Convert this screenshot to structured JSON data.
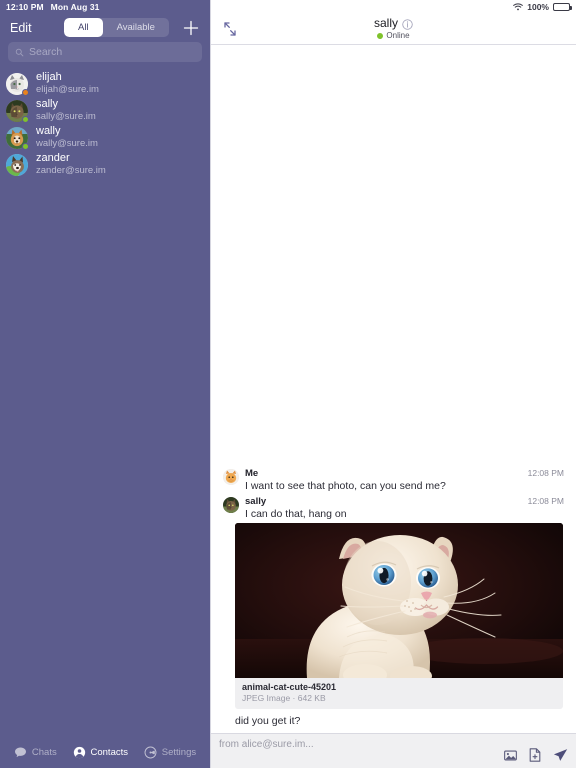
{
  "status_bar": {
    "time": "12:10 PM",
    "date": "Mon Aug 31",
    "battery_percent": "100%",
    "wifi_icon": "wifi-icon",
    "battery_icon": "battery-icon"
  },
  "sidebar": {
    "edit_label": "Edit",
    "add_button_icon": "plus-icon",
    "segmented": {
      "options": [
        "All",
        "Available"
      ],
      "selected": "All"
    },
    "search": {
      "placeholder": "Search",
      "value": "",
      "icon": "search-icon"
    },
    "contacts": [
      {
        "name": "elijah",
        "email": "elijah@sure.im",
        "presence": "away",
        "presence_color": "#e8821e",
        "avatar": "cat-gray-white"
      },
      {
        "name": "sally",
        "email": "sally@sure.im",
        "presence": "online",
        "presence_color": "#7fc22c",
        "avatar": "cat-tabby-dark"
      },
      {
        "name": "wally",
        "email": "wally@sure.im",
        "presence": "online",
        "presence_color": "#7fc22c",
        "avatar": "dog-corgi"
      },
      {
        "name": "zander",
        "email": "zander@sure.im",
        "presence": "none",
        "presence_color": "transparent",
        "avatar": "dog-husky-sky"
      }
    ],
    "tabs": [
      {
        "label": "Chats",
        "icon": "chat-bubble-icon",
        "active": false
      },
      {
        "label": "Contacts",
        "icon": "person-circle-icon",
        "active": true
      },
      {
        "label": "Settings",
        "icon": "settings-icon",
        "active": false
      }
    ]
  },
  "chat": {
    "collapse_icon": "collapse-arrows-icon",
    "title": "sally",
    "info_icon": "info-circle-icon",
    "status_text": "Online",
    "status_color": "#7fc22c",
    "messages": [
      {
        "author": "Me",
        "time": "12:08 PM",
        "text": "I want to see that photo, can you send me?",
        "avatar": "cat-orange"
      },
      {
        "author": "sally",
        "time": "12:08 PM",
        "text": "I can do that, hang on",
        "avatar": "cat-tabby-dark"
      }
    ],
    "attachment": {
      "filename": "animal-cat-cute-45201",
      "meta": "JPEG Image · 642 KB",
      "image_alt": "white kitten with blue eyes on dark background"
    },
    "trailing_text": "did you get it?",
    "composer": {
      "placeholder": "from alice@sure.im...",
      "value": "",
      "actions": [
        {
          "icon": "image-attach-icon",
          "label": "Attach image"
        },
        {
          "icon": "file-attach-icon",
          "label": "Attach file"
        },
        {
          "icon": "send-icon",
          "label": "Send"
        }
      ]
    }
  }
}
